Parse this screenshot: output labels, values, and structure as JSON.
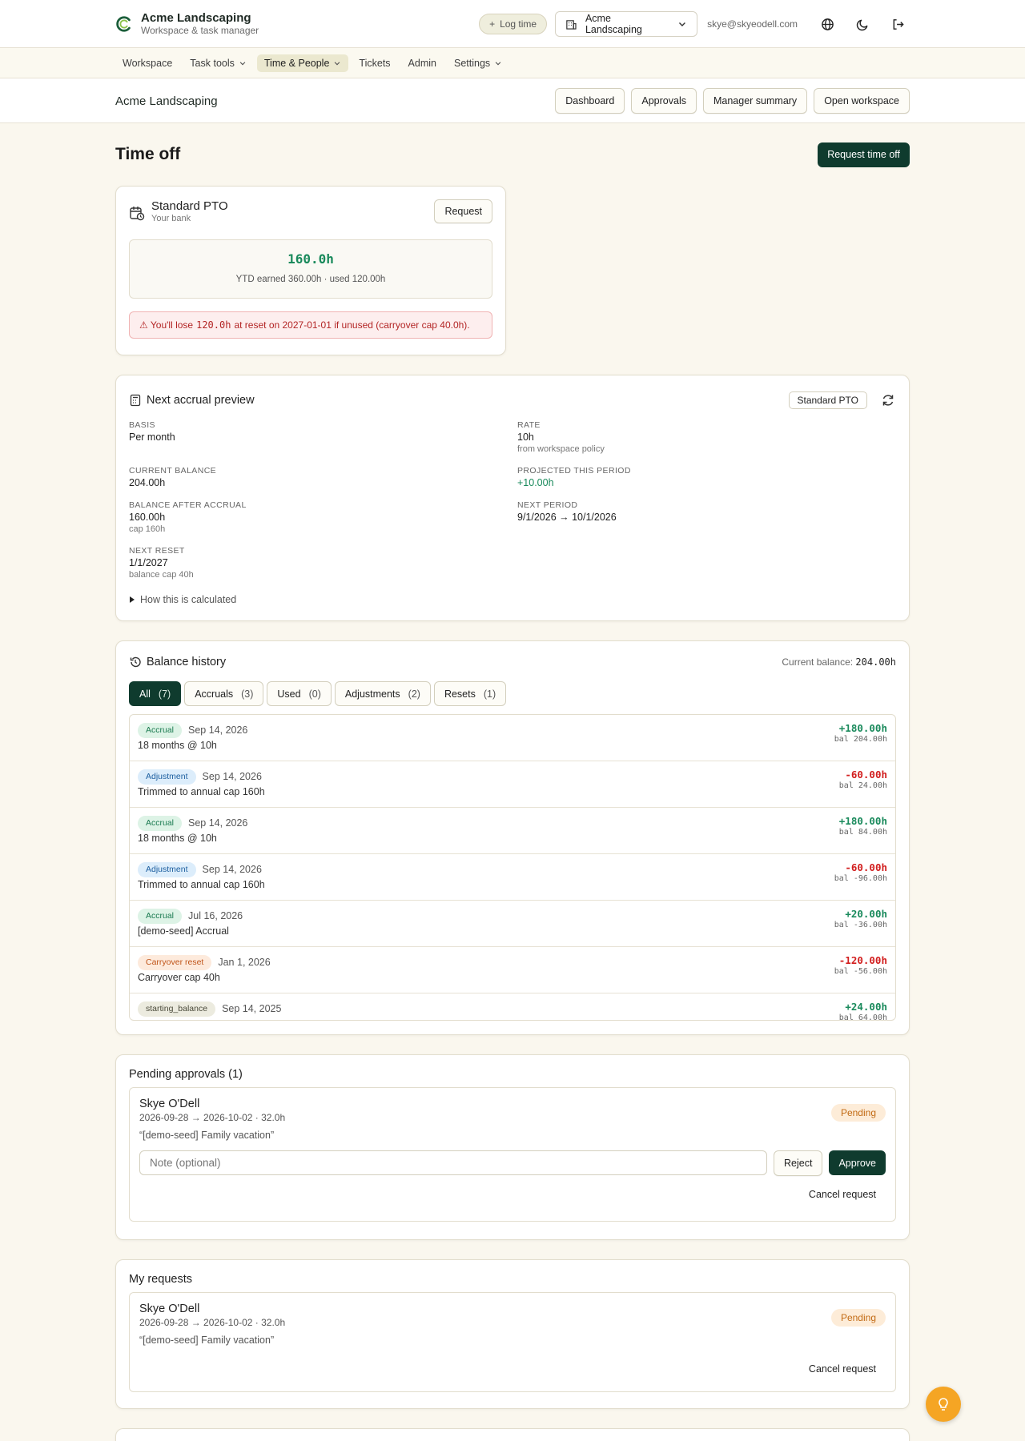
{
  "app": {
    "name": "Acme Landscaping",
    "tagline": "Workspace & task manager"
  },
  "topbar": {
    "log_time": "Log time",
    "workspace": "Acme Landscaping",
    "email": "skye@skyeodell.com",
    "icons": [
      "globe-icon",
      "moon-icon",
      "logout-icon"
    ]
  },
  "nav": {
    "items": [
      {
        "label": "Workspace"
      },
      {
        "label": "Task tools"
      },
      {
        "label": "Time & People"
      },
      {
        "label": "Tickets"
      },
      {
        "label": "Admin"
      },
      {
        "label": "Settings"
      }
    ],
    "active": "Time & People"
  },
  "subheader": {
    "title": "Acme Landscaping",
    "actions": [
      "Dashboard",
      "Approvals",
      "Manager summary",
      "Open workspace"
    ]
  },
  "page": {
    "title": "Time off",
    "request_button": "Request time off"
  },
  "pto": {
    "name": "Standard PTO",
    "sub": "Your bank",
    "request_button": "Request",
    "balance": "160.0h",
    "ytd": "YTD earned 360.00h · used 120.00h",
    "warning_prefix": "⚠ You'll lose",
    "warning_amount": "120.0h",
    "warning_suffix": "at reset on 2027-01-01 if unused (carryover cap 40.0h)."
  },
  "accrual": {
    "title": "Next accrual preview",
    "policy_tag": "Standard PTO",
    "basis_label": "Basis",
    "basis_value": "Per month",
    "rate_label": "Rate",
    "rate_value": "10h",
    "rate_note": "from workspace policy",
    "current_label": "Current balance",
    "current_value": "204.00h",
    "projected_label": "Projected this period",
    "projected_value": "+10.00h",
    "after_label": "Balance after accrual",
    "after_value": "160.00h",
    "after_note": "cap 160h",
    "next_period_label": "Next period",
    "next_period_value": "9/1/2026 → 10/1/2026",
    "reset_label": "Next reset",
    "reset_value": "1/1/2027",
    "reset_note": "balance cap 40h",
    "how": "How this is calculated"
  },
  "history": {
    "title": "Balance history",
    "current_label": "Current balance:",
    "current_value": "204.00h",
    "filters": [
      {
        "label": "All",
        "count": "(7)"
      },
      {
        "label": "Accruals",
        "count": "(3)"
      },
      {
        "label": "Used",
        "count": "(0)"
      },
      {
        "label": "Adjustments",
        "count": "(2)"
      },
      {
        "label": "Resets",
        "count": "(1)"
      }
    ],
    "rows": [
      {
        "type": "Accrual",
        "date": "Sep 14, 2026",
        "desc": "18 months @ 10h",
        "amount": "+180.00h",
        "bal": "bal 204.00h"
      },
      {
        "type": "Adjustment",
        "date": "Sep 14, 2026",
        "desc": "Trimmed to annual cap 160h",
        "amount": "-60.00h",
        "bal": "bal 24.00h"
      },
      {
        "type": "Accrual",
        "date": "Sep 14, 2026",
        "desc": "18 months @ 10h",
        "amount": "+180.00h",
        "bal": "bal 84.00h"
      },
      {
        "type": "Adjustment",
        "date": "Sep 14, 2026",
        "desc": "Trimmed to annual cap 160h",
        "amount": "-60.00h",
        "bal": "bal -96.00h"
      },
      {
        "type": "Accrual",
        "date": "Jul 16, 2026",
        "desc": "[demo-seed] Accrual",
        "amount": "+20.00h",
        "bal": "bal -36.00h"
      },
      {
        "type": "Carryover reset",
        "date": "Jan 1, 2026",
        "desc": "Carryover cap 40h",
        "amount": "-120.00h",
        "bal": "bal -56.00h"
      },
      {
        "type": "starting_balance",
        "date": "Sep 14, 2025",
        "desc": "",
        "amount": "+24.00h",
        "bal": "bal 64.00h"
      }
    ]
  },
  "approvals": {
    "title": "Pending approvals (1)",
    "request": {
      "name": "Skye O'Dell",
      "dates": "2026-09-28 → 2026-10-02 · 32.0h",
      "note": "“[demo-seed] Family vacation”",
      "status": "Pending"
    },
    "note_placeholder": "Note (optional)",
    "reject": "Reject",
    "approve": "Approve",
    "cancel": "Cancel request"
  },
  "my_requests": {
    "title": "My requests",
    "request": {
      "name": "Skye O'Dell",
      "dates": "2026-09-28 → 2026-10-02 · 32.0h",
      "note": "“[demo-seed] Family vacation”",
      "status": "Pending"
    },
    "cancel": "Cancel request"
  },
  "colors": {
    "primary": "#0f3b2e",
    "positive": "#1a8a5c",
    "negative": "#d21f1f",
    "pending": "#c26a13",
    "fab": "#f5a524"
  }
}
